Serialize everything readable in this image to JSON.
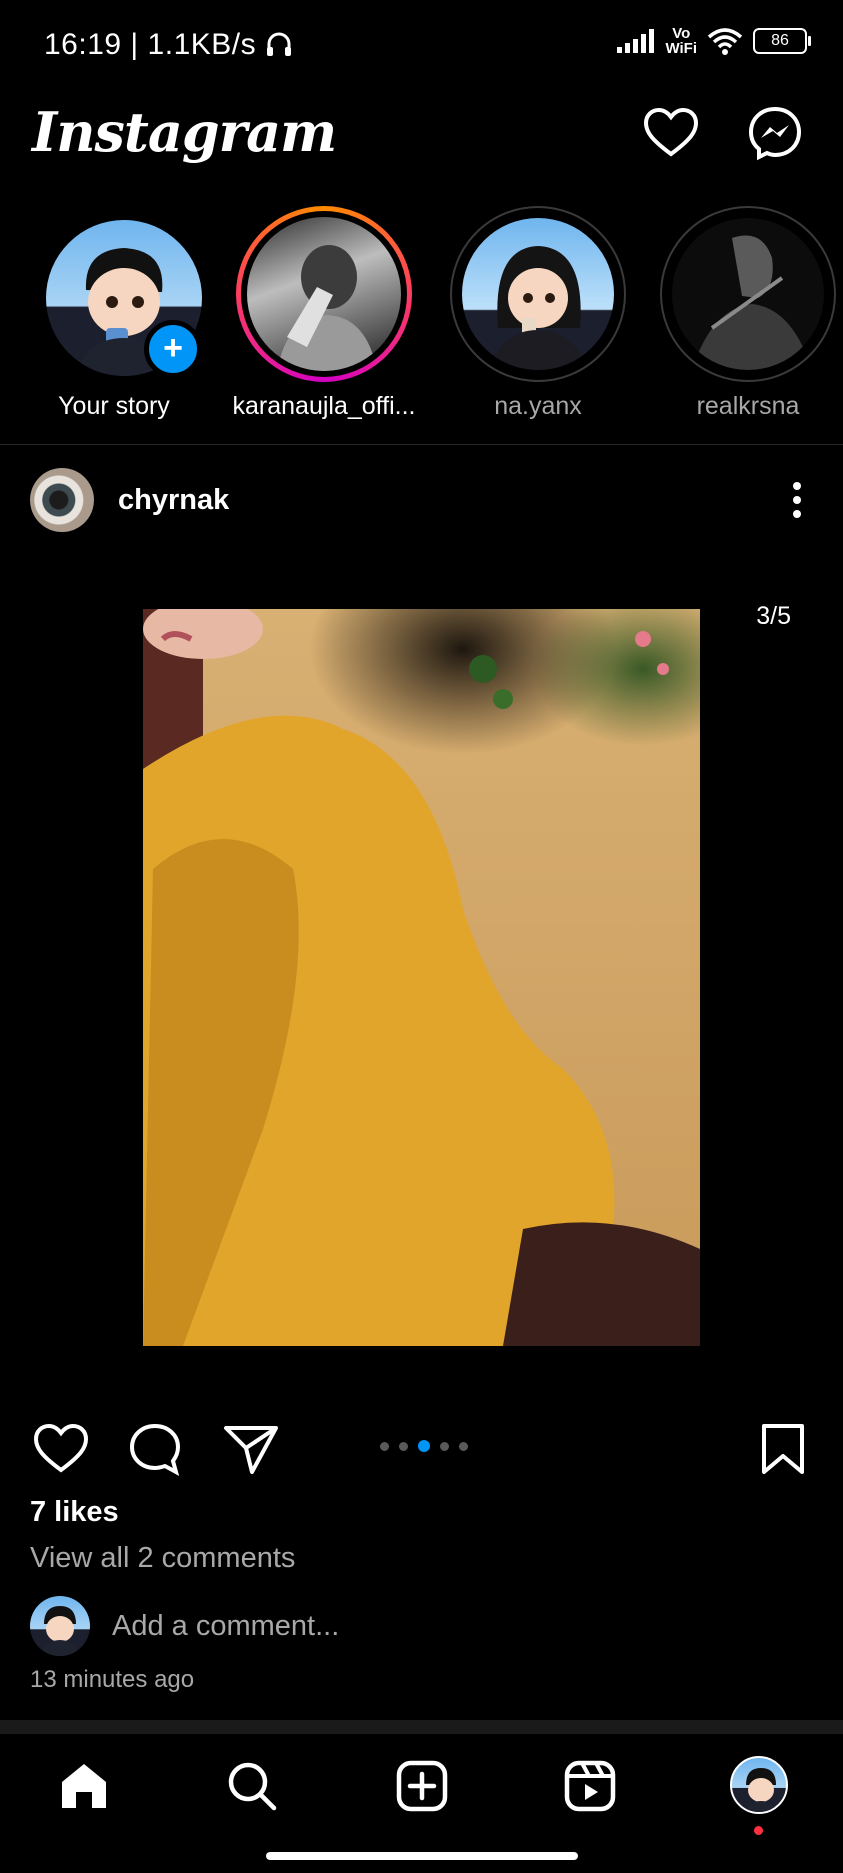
{
  "status_bar": {
    "time": "16:19",
    "speed": "1.1KB/s",
    "volte_top": "Vo",
    "volte_bottom": "WiFi",
    "battery": "86"
  },
  "header": {
    "logo": "Instagram",
    "icons": [
      "heart-icon",
      "messenger-icon"
    ]
  },
  "stories": [
    {
      "label": "Your story",
      "state": "own"
    },
    {
      "label": "karanaujla_offi...",
      "state": "unseen"
    },
    {
      "label": "na.yanx",
      "state": "seen"
    },
    {
      "label": "realkrsna",
      "state": "seen"
    }
  ],
  "post": {
    "username": "chyrnak",
    "page_counter": "3/5",
    "carousel_index": 3,
    "carousel_total": 5,
    "likes": "7 likes",
    "view_comments": "View all 2 comments",
    "add_comment_placeholder": "Add a comment...",
    "timestamp": "13 minutes ago"
  },
  "bottom_nav": {
    "items": [
      "home-icon",
      "search-icon",
      "create-icon",
      "reels-icon",
      "profile-avatar"
    ]
  },
  "colors": {
    "accent": "#0095f6",
    "background": "#000000",
    "muted_text": "#a8a8a8",
    "notification": "#ff3040"
  }
}
